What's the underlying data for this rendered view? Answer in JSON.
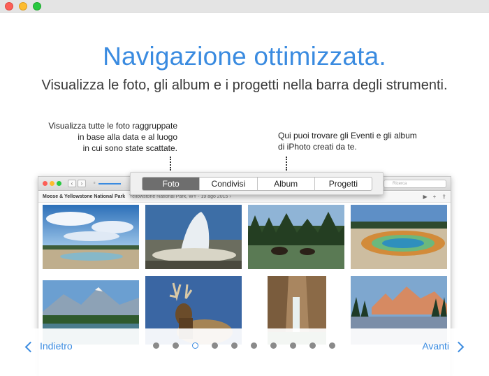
{
  "window": {
    "title": ""
  },
  "intro": {
    "headline": "Navigazione ottimizzata.",
    "subline": "Visualizza le foto, gli album e i progetti nella barra degli strumenti."
  },
  "callouts": {
    "left": [
      "Visualizza tutte le foto raggruppate",
      "in base alla data e al luogo",
      "in cui sono state scattate."
    ],
    "right": [
      "Qui puoi trovare gli Eventi e gli album",
      "di iPhoto creati da te."
    ]
  },
  "screen": {
    "search_placeholder": "Ricerca",
    "place_title": "Moose & Yellowstone National Park",
    "place_sub": "Yellowstone National Park, WY · 19 ago 2015 ›"
  },
  "tabs": [
    {
      "label": "Foto",
      "active": true
    },
    {
      "label": "Condivisi",
      "active": false
    },
    {
      "label": "Album",
      "active": false
    },
    {
      "label": "Progetti",
      "active": false
    }
  ],
  "navigation": {
    "back_label": "Indietro",
    "next_label": "Avanti",
    "page_count": 10,
    "current_page": 3
  },
  "colors": {
    "accent": "#3a8be0",
    "active_tab": "#6e6e6e"
  }
}
